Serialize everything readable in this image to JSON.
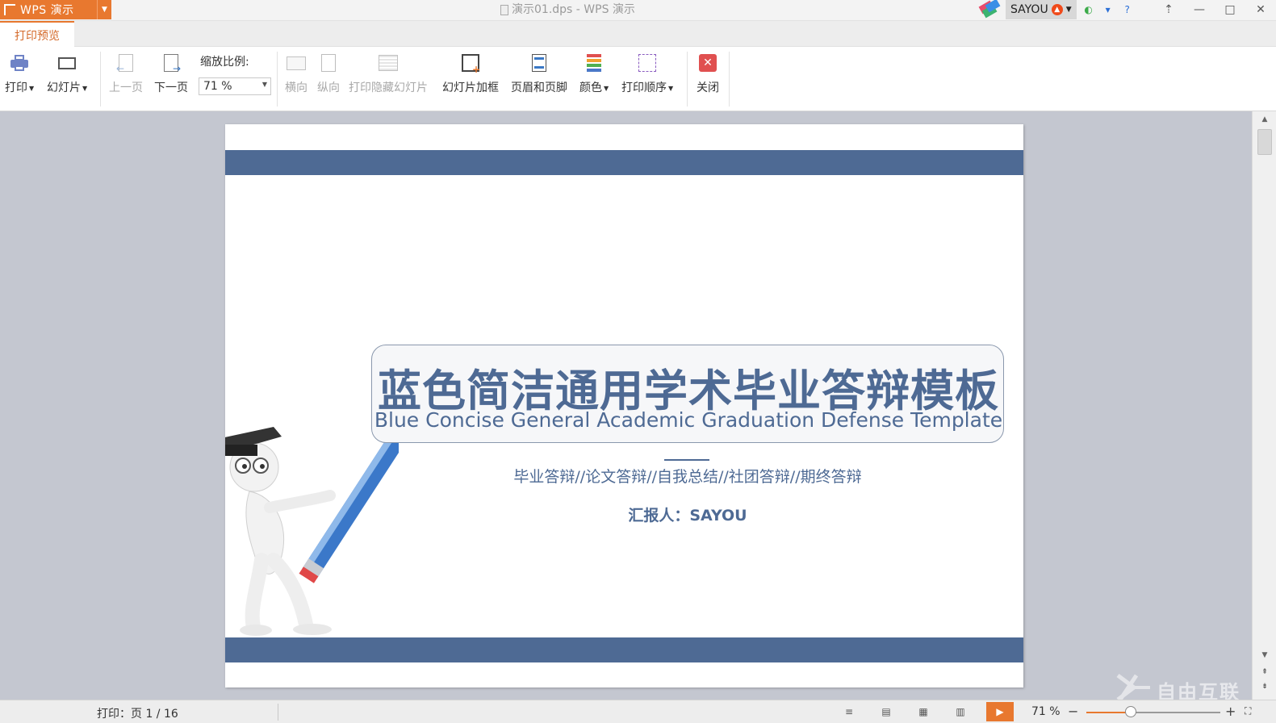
{
  "titlebar": {
    "app_name": "WPS 演示",
    "doc_title": "演示01.dps - WPS 演示",
    "username": "SAYOU"
  },
  "tabs": [
    {
      "label": "打印预览",
      "active": true
    }
  ],
  "ribbon": {
    "print": "打印",
    "slides": "幻灯片",
    "prev_page": "上一页",
    "next_page": "下一页",
    "zoom_label": "缩放比例:",
    "zoom_value": "71 %",
    "landscape": "横向",
    "portrait": "纵向",
    "print_hidden": "打印隐藏幻灯片",
    "slide_frame": "幻灯片加框",
    "header_footer": "页眉和页脚",
    "color": "颜色",
    "print_order": "打印顺序",
    "close": "关闭"
  },
  "slide": {
    "title_cn": "蓝色简洁通用学术毕业答辩模板",
    "title_en": "Blue Concise General Academic Graduation Defense Template",
    "subtitle": "毕业答辩//论文答辩//自我总结//社团答辩//期终答辩",
    "reporter": "汇报人：SAYOU",
    "accent_color": "#4e6a94"
  },
  "statusbar": {
    "print_status": "打印：页 1 / 16",
    "zoom": "71 %",
    "zoom_fraction": 0.33
  },
  "colors": {
    "brand_orange": "#e8782f",
    "slide_blue": "#4e6a94"
  },
  "watermark": {
    "text": "自由互联"
  }
}
